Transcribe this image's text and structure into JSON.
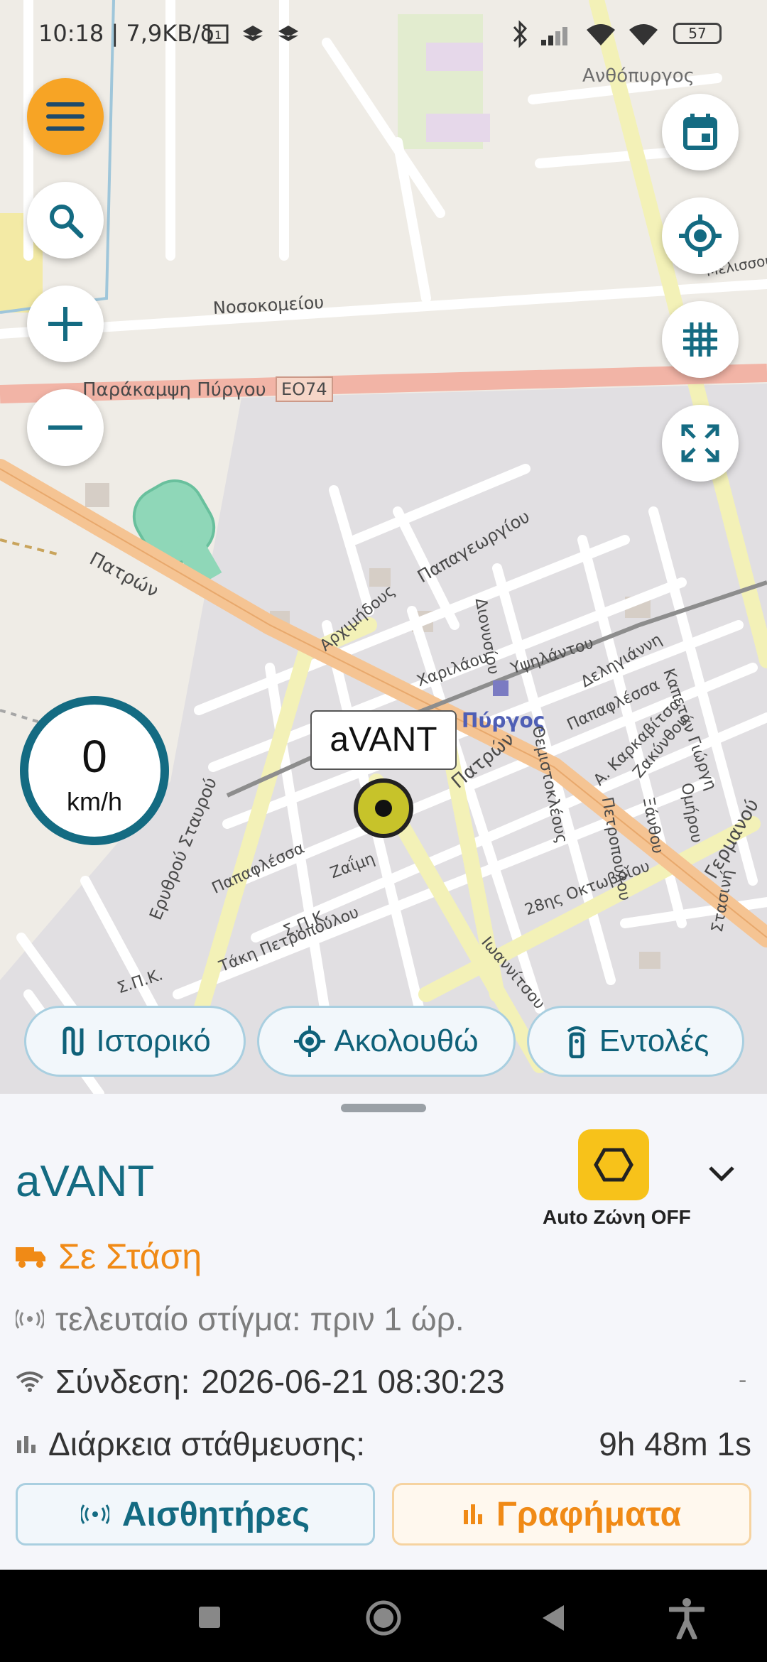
{
  "status_bar": {
    "time": "10:18 | 7,9KB/δ",
    "battery": "57"
  },
  "map": {
    "labels": {
      "nosokomeiou": "Νοσοκομείου",
      "parakampsi": "Παράκαμψη Πύργου",
      "eo74": "ΕΟ74",
      "patron": "Πατρών",
      "patron2": "Πατρών",
      "papagewrgiou": "Παπαγεωργίου",
      "archimidous": "Αρχιμήδους",
      "dionysiou": "Διονυσίου",
      "charilaou": "Χαριλάου",
      "ypsilantou": "Υψηλάντου",
      "pyrgos": "Πύργος",
      "anthopyrgos": "Ανθόπυργος",
      "melissou": "Μελισσού",
      "deligianni": "Δεληγιάννη",
      "kapetan": "Καπετάν Γιώργη",
      "papaflessa": "Παπαφλέσσα",
      "papaflessa2": "Παπαφλέσσα",
      "themistokleous": "Θεμιστοκλέους",
      "karkavitsa": "Α. Καρκαβίτσα",
      "zakynthou": "Ζακύνθου",
      "petropoulou": "Πετροπούλου",
      "xanthou": "Ξάνθου",
      "omirou": "Ομήρου",
      "erythrou": "Ερυθρού Σταυρού",
      "zaimi": "Ζαΐμη",
      "spk": "Σ.Π.Κ.",
      "takis": "Τάκη Πετροπούλου",
      "oktovriou": "28ης Οκτωβρίου",
      "ioannitsou": "Ιωαννίτσου",
      "germanou": "Γερμανού",
      "stasini": "Στασινή",
      "spk2": "Σ.Π.Κ."
    }
  },
  "marker": {
    "label": "aVANT"
  },
  "speed": {
    "value": "0",
    "unit": "km/h"
  },
  "chips": {
    "history": "Ιστορικό",
    "follow": "Ακολουθώ",
    "commands": "Εντολές"
  },
  "sheet": {
    "vehicle_name": "aVANT",
    "zone_label": "Auto Ζώνη OFF",
    "status": "Σε Στάση",
    "last_fix": "τελευταίο στίγμα: πριν 1 ώρ.",
    "connection_label": "Σύνδεση:",
    "connection_value": "2026-06-21 08:30:23",
    "connection_dash": "-",
    "parking_label": "Διάρκεια στάθμευσης:",
    "parking_value": "9h 48m 1s",
    "sensors_button": "Αισθητήρες",
    "charts_button": "Γραφήματα"
  },
  "colors": {
    "accent": "#146b82",
    "orange": "#f7a425",
    "status_orange": "#f08a16",
    "zone_yellow": "#f7c21a"
  },
  "icons": [
    "menu-icon",
    "search-icon",
    "zoom-in-icon",
    "zoom-out-icon",
    "calendar-icon",
    "locate-icon",
    "grid-icon",
    "fullscreen-icon",
    "history-icon",
    "follow-icon",
    "remote-icon",
    "hexagon-icon",
    "chevron-down-icon",
    "truck-icon",
    "signal-icon",
    "wifi-icon",
    "bar-chart-icon",
    "square-icon",
    "circle-icon",
    "back-icon",
    "accessibility-icon"
  ]
}
